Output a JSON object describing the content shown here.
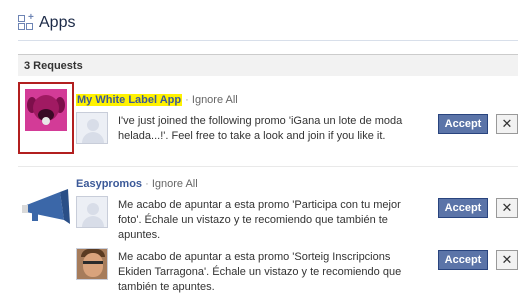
{
  "header": {
    "title": "Apps",
    "icon": "apps-icon"
  },
  "requests_header": "3 Requests",
  "apps": [
    {
      "name": "My White Label App",
      "highlighted": true,
      "separator": "·",
      "ignore_all": "Ignore All",
      "icon": "pink-dog-icon",
      "requests": [
        {
          "avatar": "default-silhouette",
          "text": "I've just joined the following promo 'iGana un lote de moda helada...!'. Feel free to take a look and join if you like it.",
          "accept_label": "Accept",
          "ignore_label": "✕"
        }
      ]
    },
    {
      "name": "Easypromos",
      "highlighted": false,
      "separator": "·",
      "ignore_all": "Ignore All",
      "icon": "megaphone-icon",
      "requests": [
        {
          "avatar": "default-silhouette",
          "text": "Me acabo de apuntar a esta promo 'Participa con tu mejor foto'. Échale un vistazo y te recomiendo que también te apuntes.",
          "accept_label": "Accept",
          "ignore_label": "✕"
        },
        {
          "avatar": "user-photo",
          "text": "Me acabo de apuntar a esta promo 'Sorteig Inscripcions Ekiden Tarragona'. Échale un vistazo y te recomiendo que también te apuntes.",
          "accept_label": "Accept",
          "ignore_label": "✕"
        }
      ]
    }
  ],
  "colors": {
    "accent": "#3b5998",
    "accept_bg": "#5b74a8",
    "highlight": "#fff200",
    "icon_border": "#b21f1f"
  }
}
